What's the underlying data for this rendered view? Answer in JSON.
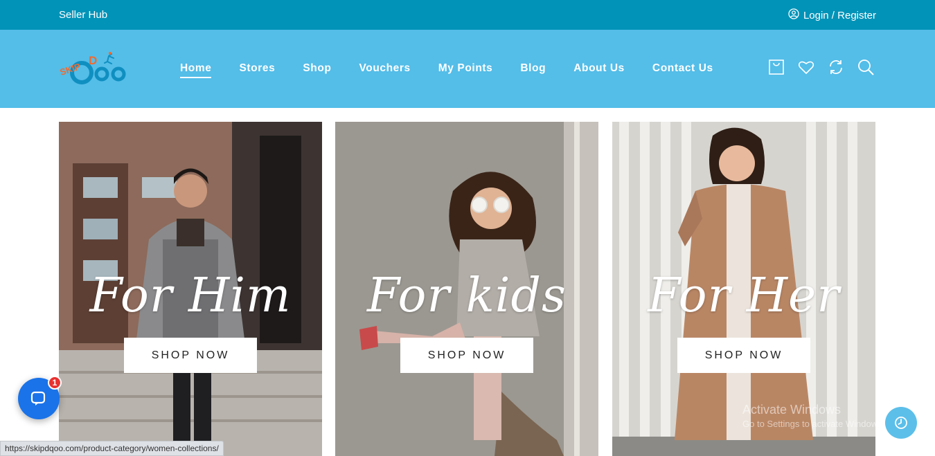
{
  "topbar": {
    "seller_hub": "Seller Hub",
    "login_register": "Login / Register",
    "user_icon": "user-circle-icon"
  },
  "header": {
    "logo_text": "SKIP D QOO",
    "nav": [
      {
        "label": "Home",
        "active": true
      },
      {
        "label": "Stores"
      },
      {
        "label": "Shop"
      },
      {
        "label": "Vouchers"
      },
      {
        "label": "My Points"
      },
      {
        "label": "Blog"
      },
      {
        "label": "About Us"
      },
      {
        "label": "Contact Us"
      }
    ],
    "icons": [
      "cart-icon",
      "heart-icon",
      "compare-icon",
      "search-icon"
    ]
  },
  "cards": [
    {
      "title": "For Him",
      "button": "SHOP NOW"
    },
    {
      "title": "For kids",
      "button": "SHOP NOW"
    },
    {
      "title": "For Her",
      "button": "SHOP NOW"
    }
  ],
  "chat": {
    "badge_count": "1",
    "icon": "chat-bubble-icon"
  },
  "status_url": "https://skipdqoo.com/product-category/women-collections/",
  "watermark": {
    "line1": "Activate Windows",
    "line2": "Go to Settings to activate Windows."
  },
  "colors": {
    "topbar": "#0293b8",
    "header": "#54bde8",
    "logo_orange": "#f26a2e",
    "logo_blue": "#0f8fc0",
    "chat_blue": "#1a73e8",
    "badge_red": "#e8312f"
  }
}
